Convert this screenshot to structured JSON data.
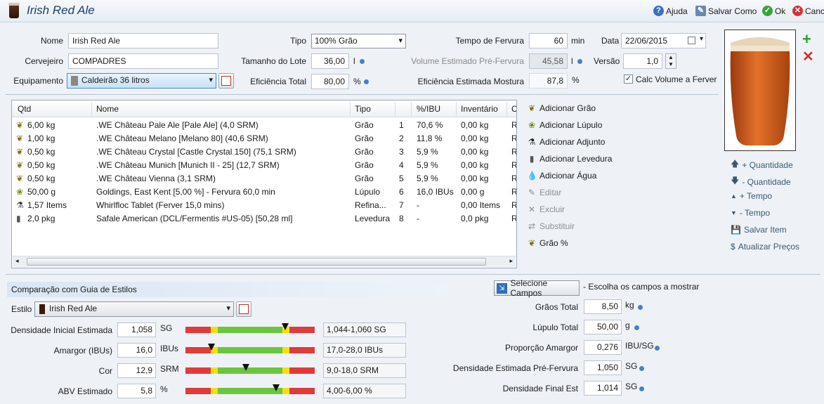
{
  "window": {
    "title": "Irish Red Ale",
    "help_label": "Ajuda",
    "save_as_label": "Salvar Como",
    "ok_label": "Ok",
    "cancel_label": "Canc"
  },
  "form": {
    "name_label": "Nome",
    "name_value": "Irish Red Ale",
    "brewer_label": "Cervejeiro",
    "brewer_value": "COMPADRES",
    "equipment_label": "Equipamento",
    "equipment_value": "Caldeirão 36 litros",
    "type_label": "Tipo",
    "type_value": "100% Grão",
    "batch_label": "Tamanho do Lote",
    "batch_value": "36,00",
    "batch_unit": "l",
    "efficiency_label": "Eficiência Total",
    "efficiency_value": "80,00",
    "efficiency_unit": "%",
    "boil_time_label": "Tempo de Fervura",
    "boil_time_value": "60",
    "boil_time_unit": "min",
    "pre_boil_label": "Volume Estimado Pré-Fervura",
    "pre_boil_value": "45,58",
    "pre_boil_unit": "l",
    "mash_eff_label": "Eficiência Estimada Mostura",
    "mash_eff_value": "87,8",
    "mash_eff_unit": "%",
    "date_label": "Data",
    "date_value": "22/06/2015",
    "version_label": "Versão",
    "version_value": "1,0",
    "calc_boil_label": "Calc Volume a Ferver"
  },
  "table": {
    "columns": [
      "Qtd",
      "Nome",
      "Tipo",
      "",
      "%/IBU",
      "Inventário",
      "C"
    ],
    "rows": [
      {
        "icon": "grain",
        "qty": "6,00 kg",
        "name": ".WE Château Pale Ale [Pale Ale] (4,0 SRM)",
        "type": "Grão",
        "n": "1",
        "pct": "70,6 %",
        "inv": "0,00 kg",
        "c": "R"
      },
      {
        "icon": "grain",
        "qty": "1,00 kg",
        "name": ".WE Château Melano [Melano 80] (40,6 SRM)",
        "type": "Grão",
        "n": "2",
        "pct": "11,8 %",
        "inv": "0,00 kg",
        "c": "R"
      },
      {
        "icon": "grain",
        "qty": "0,50 kg",
        "name": ".WE Château Crystal [Castle Crystal 150] (75,1 SRM)",
        "type": "Grão",
        "n": "3",
        "pct": "5,9 %",
        "inv": "0,00 kg",
        "c": "R"
      },
      {
        "icon": "grain",
        "qty": "0,50 kg",
        "name": ".WE Château Munich [Munich II - 25] (12,7 SRM)",
        "type": "Grão",
        "n": "4",
        "pct": "5,9 %",
        "inv": "0,00 kg",
        "c": "R"
      },
      {
        "icon": "grain",
        "qty": "0,50 kg",
        "name": ".WE Château Vienna (3,1 SRM)",
        "type": "Grão",
        "n": "5",
        "pct": "5,9 %",
        "inv": "0,00 kg",
        "c": "R"
      },
      {
        "icon": "hop",
        "qty": "50,00 g",
        "name": "Goldings, East Kent [5,00 %] - Fervura 60,0 min",
        "type": "Lúpulo",
        "n": "6",
        "pct": "16,0 IBUs",
        "inv": "0,00 g",
        "c": "R"
      },
      {
        "icon": "adjunct",
        "qty": "1,57 Items",
        "name": "Whirlfloc Tablet (Ferver 15,0 mins)",
        "type": "Refina...",
        "n": "7",
        "pct": "-",
        "inv": "0,00 Items",
        "c": "R"
      },
      {
        "icon": "yeast",
        "qty": "2,0 pkg",
        "name": "Safale American  (DCL/Fermentis #US-05) [50,28 ml]",
        "type": "Levedura",
        "n": "8",
        "pct": "-",
        "inv": "0,0 pkg",
        "c": "R"
      }
    ]
  },
  "actions": {
    "add_grain": "Adicionar Grão",
    "add_hop": "Adicionar Lúpulo",
    "add_adjunct": "Adicionar Adjunto",
    "add_yeast": "Adicionar Levedura",
    "add_water": "Adicionar Água",
    "edit": "Editar",
    "delete": "Excluir",
    "replace": "Substituir",
    "grain_pct": "Grão %",
    "qty_up": "+ Quantidade",
    "qty_down": "- Quantidade",
    "time_up": "+ Tempo",
    "time_down": "- Tempo",
    "save_item": "Salvar Item",
    "update_prices": "Atualizar Preços"
  },
  "style": {
    "section_title": "Comparação com Guia de Estilos",
    "style_label": "Estilo",
    "style_value": "Irish Red Ale",
    "rows": [
      {
        "label": "Densidade Inicial Estimada",
        "value": "1,058",
        "unit": "SG",
        "range": "1,044-1,060 SG",
        "position": 0.77
      },
      {
        "label": "Amargor (IBUs)",
        "value": "16,0",
        "unit": "IBUs",
        "range": "17,0-28,0 IBUs",
        "position": 0.2
      },
      {
        "label": "Cor",
        "value": "12,9",
        "unit": "SRM",
        "range": "9,0-18,0 SRM",
        "position": 0.47
      },
      {
        "label": "ABV Estimado",
        "value": "5,8",
        "unit": "%",
        "range": "4,00-6,00 %",
        "position": 0.7
      }
    ]
  },
  "fields": {
    "select_button": "Selecione Campos",
    "select_hint": "- Escolha os campos a mostrar",
    "rows": [
      {
        "label": "Grãos Total",
        "value": "8,50",
        "unit": "kg"
      },
      {
        "label": "Lúpulo Total",
        "value": "50,00",
        "unit": "g"
      },
      {
        "label": "Proporção Amargor",
        "value": "0,276",
        "unit": "IBU/SG"
      },
      {
        "label": "Densidade Estimada Pré-Fervura",
        "value": "1,050",
        "unit": "SG"
      },
      {
        "label": "Densidade Final Est",
        "value": "1,014",
        "unit": "SG"
      }
    ]
  },
  "colors": {
    "accent": "#1f3d6b",
    "beer": "#c8541a",
    "bar_red": "#e03a3a",
    "bar_yellow": "#f2e10f",
    "bar_green": "#6cc63d"
  }
}
